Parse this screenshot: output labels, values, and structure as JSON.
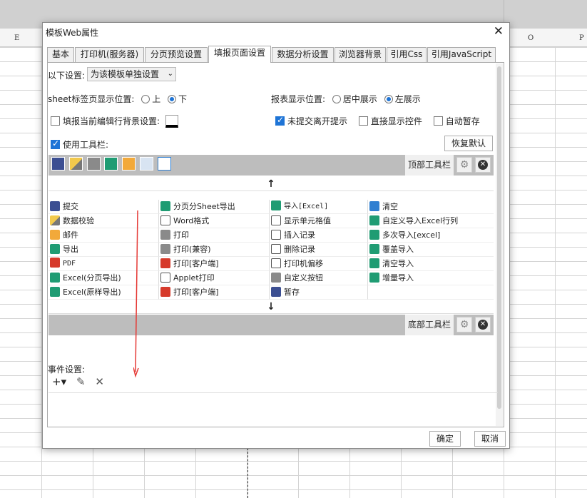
{
  "sheet": {
    "columns": [
      "E",
      "O",
      "P"
    ]
  },
  "dialog": {
    "title": "模板Web属性",
    "close": "✕",
    "tabs": [
      "基本",
      "打印机(服务器)",
      "分页预览设置",
      "填报页面设置",
      "数据分析设置",
      "浏览器背景",
      "引用Css",
      "引用JavaScript"
    ],
    "active_tab": "填报页面设置",
    "settings": {
      "label": "以下设置:",
      "value": "为该模板单独设置",
      "arrow": "⌄"
    },
    "sheet_tab_position": {
      "label": "sheet标签页显示位置:",
      "options": [
        "上",
        "下"
      ],
      "selected": "下"
    },
    "report_position": {
      "label": "报表显示位置:",
      "options": [
        "居中展示",
        "左展示"
      ],
      "selected": "左展示"
    },
    "checks": {
      "fill_bg": "填报当前编辑行背景设置:",
      "unsubmitted_prompt": "未提交离开提示",
      "show_controls": "直接显示控件",
      "auto_save": "自动暂存",
      "use_toolbar": "使用工具栏:"
    },
    "restore_default": "恢复默认",
    "top_toolbar_label": "顶部工具栏",
    "bottom_toolbar_label": "底部工具栏",
    "up_arrow": "↑",
    "down_arrow": "↓",
    "toolbar_items": [
      [
        "提交",
        "分页分Sheet导出",
        "导入[Excel]",
        "清空"
      ],
      [
        "数据校验",
        "Word格式",
        "显示单元格值",
        "自定义导入Excel行列"
      ],
      [
        "邮件",
        "打印",
        "插入记录",
        "多次导入[excel]"
      ],
      [
        "导出",
        "打印(兼容)",
        "删除记录",
        "覆盖导入"
      ],
      [
        "PDF",
        "打印[客户端]",
        "打印机偏移",
        "清空导入"
      ],
      [
        "Excel(分页导出)",
        "Applet打印",
        "自定义按钮",
        "增量导入"
      ],
      [
        "Excel(原样导出)",
        "打印[客户端]",
        "暂存",
        ""
      ]
    ],
    "event_label": "事件设置:",
    "event_tools": [
      "+▾",
      "✎",
      "✕"
    ],
    "ok": "确定",
    "cancel": "取消"
  },
  "colors": {
    "accent": "#1e74d6",
    "excel_green": "#1f9c73",
    "annotation_red": "#e53935"
  }
}
